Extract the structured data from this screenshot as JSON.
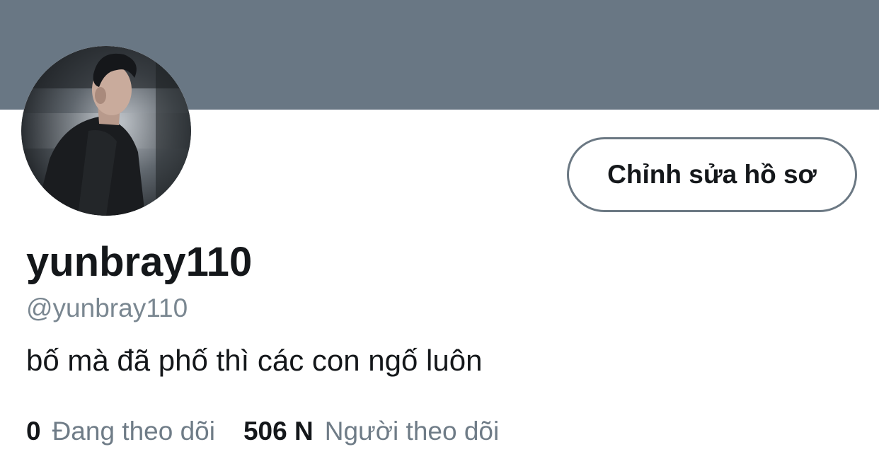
{
  "profile": {
    "display_name": "yunbray110",
    "handle": "@yunbray110",
    "bio": "bố mà đã phố thì các con ngố luôn",
    "edit_button_label": "Chỉnh sửa hồ sơ",
    "avatar_icon": "profile-photo"
  },
  "stats": {
    "following_count": "0",
    "following_label": "Đang theo dõi",
    "followers_count": "506 N",
    "followers_label": "Người theo dõi"
  },
  "colors": {
    "banner": "#697784",
    "text_primary": "#14171a",
    "text_secondary": "#6f7c87",
    "button_border": "#6b7883"
  }
}
